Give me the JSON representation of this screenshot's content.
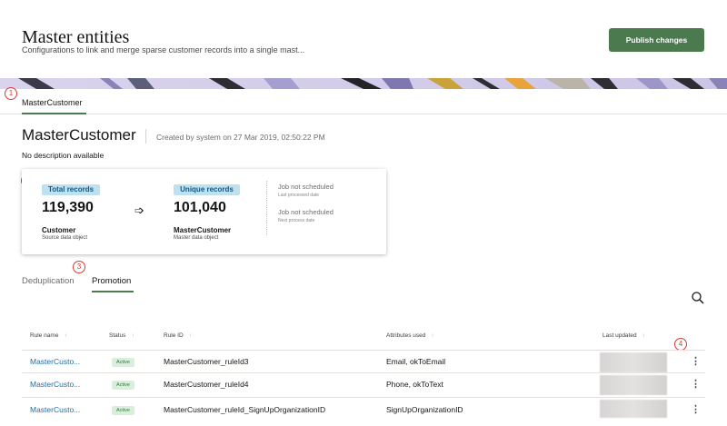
{
  "header": {
    "title": "Master entities",
    "subtitle": "Configurations to link and merge sparse customer records into a single mast...",
    "publish_label": "Publish changes"
  },
  "tabs_top": {
    "active": "MasterCustomer"
  },
  "callouts": [
    "1",
    "2",
    "3",
    "4"
  ],
  "entity": {
    "name": "MasterCustomer",
    "meta": "Created by system on 27 Mar 2019, 02:50:22 PM",
    "description": "No description available"
  },
  "stats": {
    "total_label": "Total records",
    "total_value": "119,390",
    "source_name": "Customer",
    "source_sub": "Source data object",
    "unique_label": "Unique records",
    "unique_value": "101,040",
    "master_name": "MasterCustomer",
    "master_sub": "Master data object",
    "job1": "Job not scheduled",
    "job1_sub": "Last processed date",
    "job2": "Job not scheduled",
    "job2_sub": "Next process date"
  },
  "subtabs": [
    {
      "label": "Deduplication",
      "active": false
    },
    {
      "label": "Promotion",
      "active": true
    }
  ],
  "table": {
    "columns": [
      "Rule name",
      "Status",
      "Rule ID",
      "Attributes used",
      "Last updated"
    ],
    "rows": [
      {
        "name": "MasterCusto...",
        "status": "Active",
        "rule_id": "MasterCustomer_ruleId3",
        "attributes": "Email, okToEmail"
      },
      {
        "name": "MasterCusto...",
        "status": "Active",
        "rule_id": "MasterCustomer_ruleId4",
        "attributes": "Phone, okToText"
      },
      {
        "name": "MasterCusto...",
        "status": "Active",
        "rule_id": "MasterCustomer_ruleId_SignUpOrganizationID",
        "attributes": "SignUpOrganizationID"
      }
    ]
  },
  "icons": {
    "search": "search-icon",
    "sort": "sort-arrow-icon",
    "arrow": "arrow-right-icon",
    "more": "kebab-menu-icon"
  },
  "colors": {
    "accent": "#4a7a4e",
    "link": "#1c6ea4",
    "badge_blue": "#bfe1ef",
    "status_green": "#dbeedd",
    "callout": "#d13f36"
  }
}
